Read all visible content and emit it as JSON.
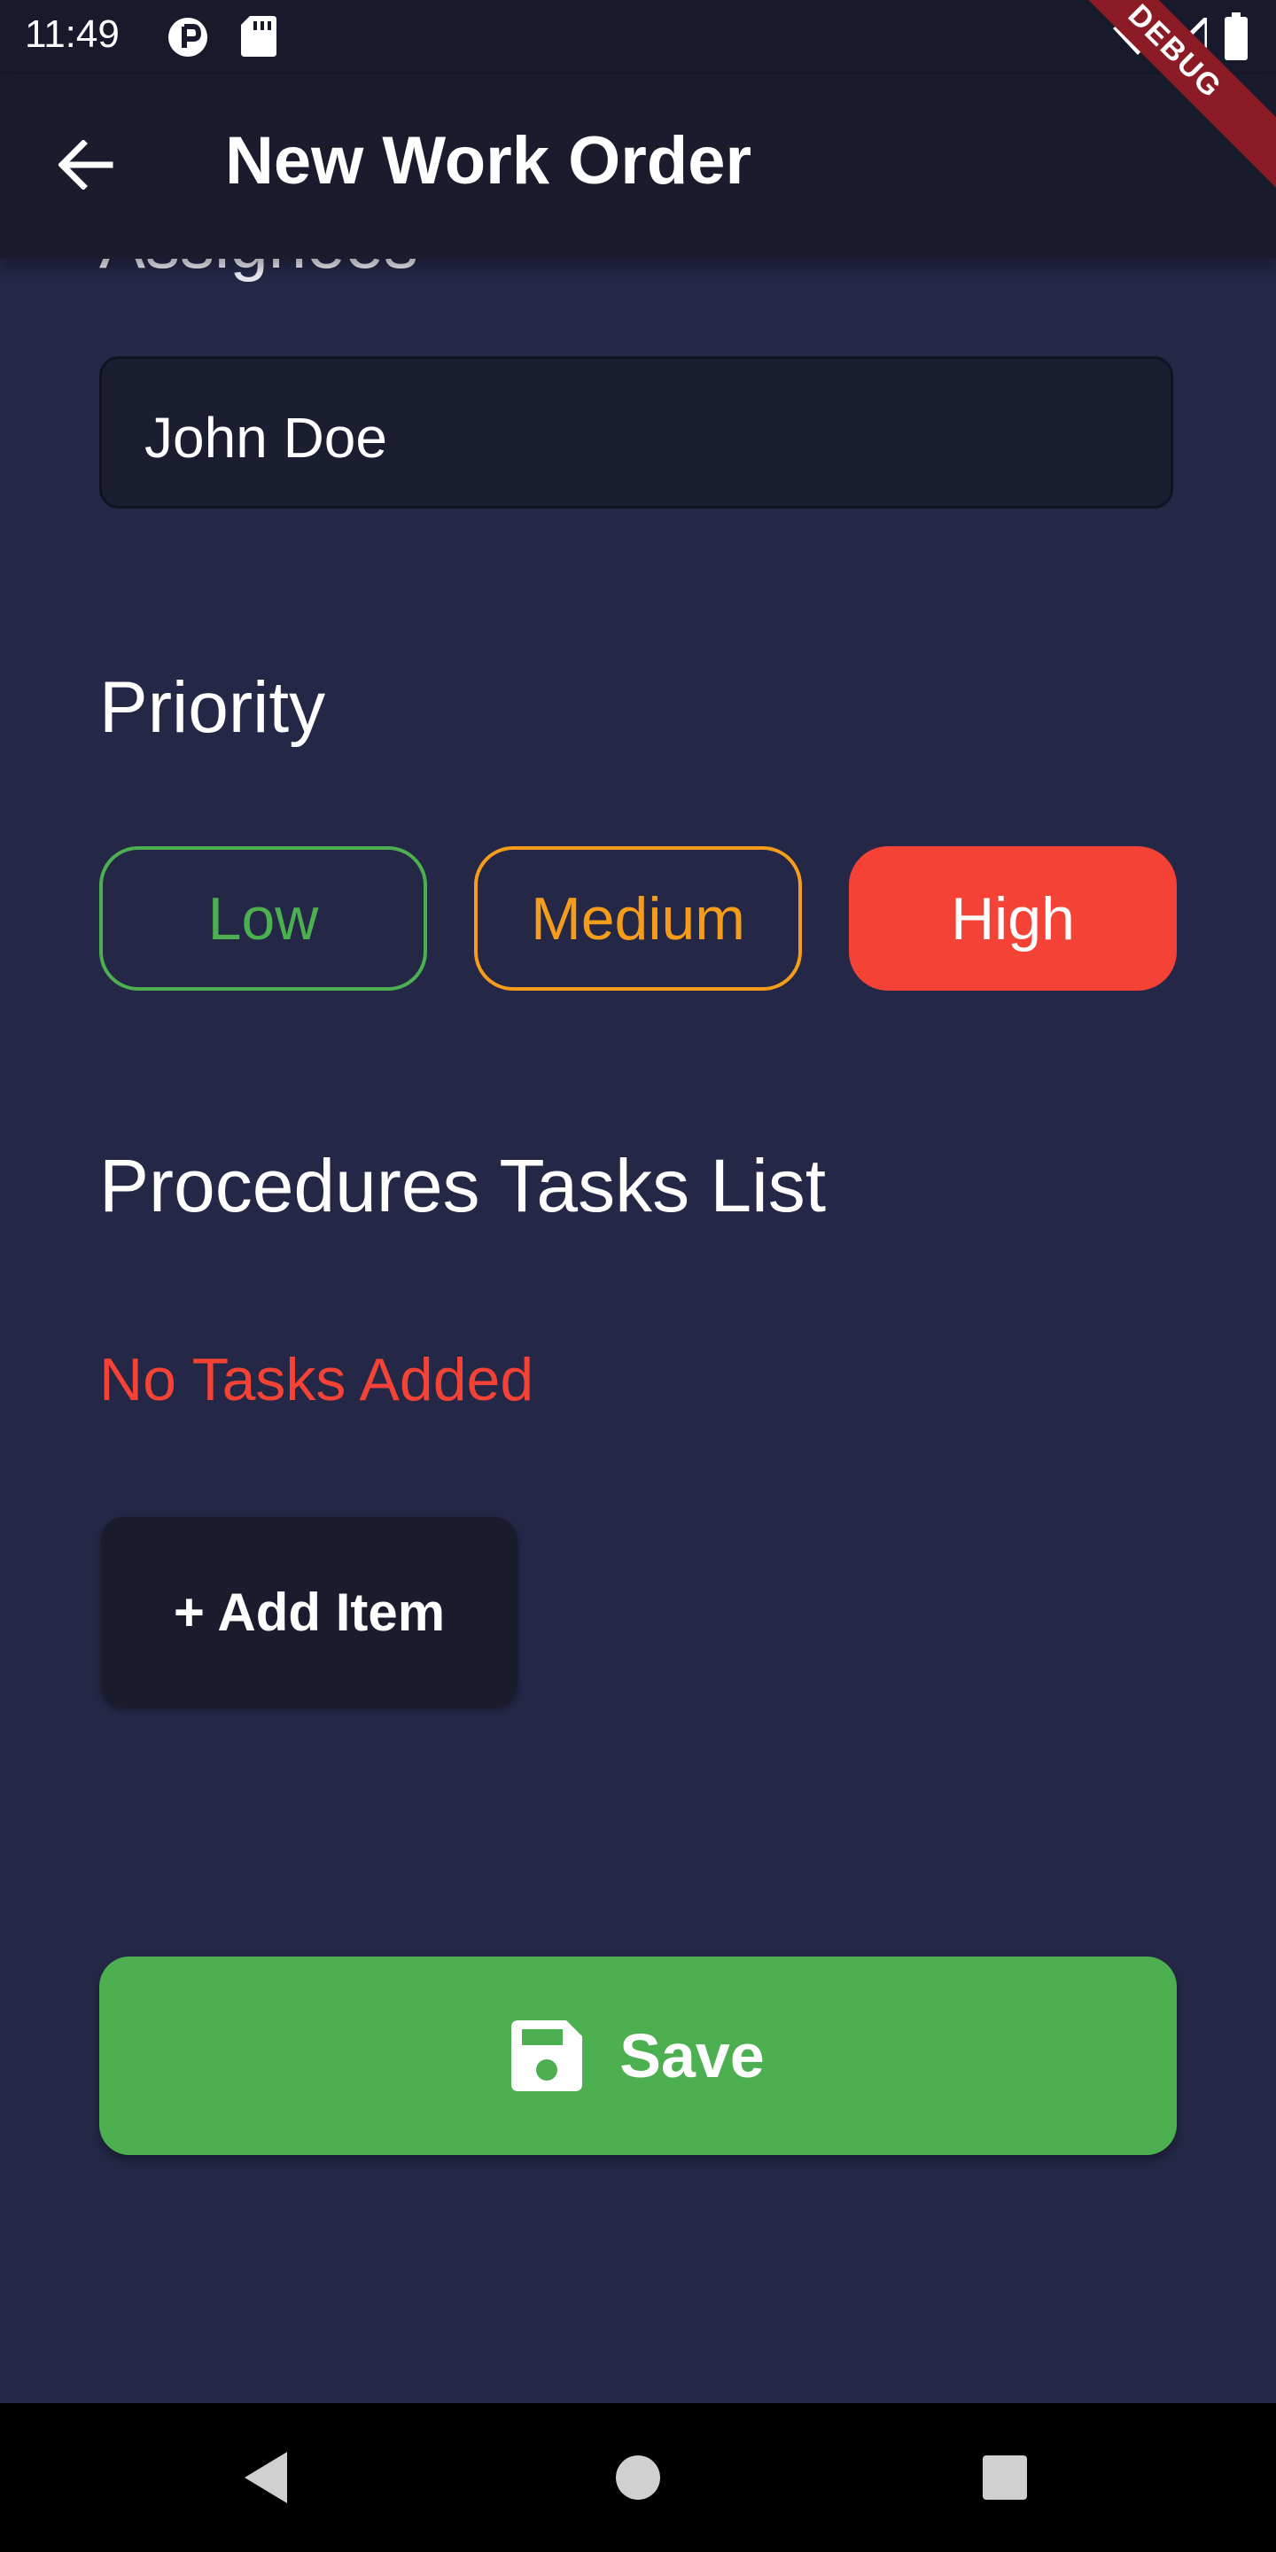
{
  "status_bar": {
    "time": "11:49",
    "icons": [
      "app-notification-icon",
      "sd-card-icon",
      "wifi-icon",
      "signal-icon",
      "battery-icon"
    ]
  },
  "app_bar": {
    "title": "New Work Order",
    "back_icon": "arrow-left-icon",
    "debug_banner": "DEBUG"
  },
  "form": {
    "assignees_label": "Assignees",
    "assignee_value": "John Doe",
    "priority_label": "Priority",
    "priority_options": [
      {
        "label": "Low",
        "color": "#4caf50",
        "selected": false
      },
      {
        "label": "Medium",
        "color": "#f59c1a",
        "selected": false
      },
      {
        "label": "High",
        "color": "#f44336",
        "selected": true
      }
    ],
    "tasks_title": "Procedures Tasks List",
    "no_tasks_text": "No Tasks Added",
    "add_item_label": "+ Add Item",
    "save_label": "Save",
    "save_icon": "floppy-disk-icon"
  },
  "nav_bar": {
    "buttons": [
      "back-triangle-icon",
      "home-circle-icon",
      "recents-square-icon"
    ]
  },
  "colors": {
    "background": "#242746",
    "app_bar": "#1a1c2e",
    "accent_green": "#4caf50",
    "error_red": "#f44336"
  }
}
